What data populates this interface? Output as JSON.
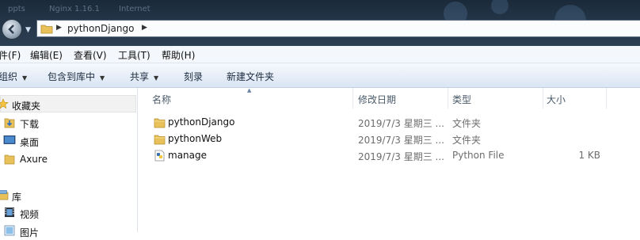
{
  "window": {
    "address_crumb": "pythonDjango",
    "bg_hints": [
      "ppts",
      "Nginx 1.16.1",
      "Internet"
    ]
  },
  "menu": {
    "items": [
      "件(F)",
      "编辑(E)",
      "查看(V)",
      "工具(T)",
      "帮助(H)"
    ]
  },
  "toolbar": {
    "items": [
      {
        "label": "组织",
        "dropdown": true
      },
      {
        "label": "包含到库中",
        "dropdown": true
      },
      {
        "label": "共享",
        "dropdown": true
      },
      {
        "label": "刻录",
        "dropdown": false
      },
      {
        "label": "新建文件夹",
        "dropdown": false
      }
    ]
  },
  "navpane": {
    "items": [
      {
        "label": "收藏夹",
        "icon": "favorites-star-icon"
      },
      {
        "label": "下载",
        "icon": "download-folder-icon"
      },
      {
        "label": "桌面",
        "icon": "desktop-icon"
      },
      {
        "label": "Axure",
        "icon": "folder-icon"
      },
      {
        "label": "库",
        "icon": "library-icon"
      },
      {
        "label": "视频",
        "icon": "video-library-icon"
      },
      {
        "label": "图片",
        "icon": "picture-library-icon"
      }
    ]
  },
  "columns": [
    "名称",
    "修改日期",
    "类型",
    "大小"
  ],
  "files": [
    {
      "name": "pythonDjango",
      "date": "2019/7/3 星期三 ...",
      "type": "文件夹",
      "size": "",
      "icon": "folder-icon"
    },
    {
      "name": "pythonWeb",
      "date": "2019/7/3 星期三 ...",
      "type": "文件夹",
      "size": "",
      "icon": "folder-icon"
    },
    {
      "name": "manage",
      "date": "2019/7/3 星期三 ...",
      "type": "Python File",
      "size": "1 KB",
      "icon": "python-file-icon"
    }
  ],
  "colors": {
    "folder": "#e8c15a",
    "accent": "#3a6ea5"
  }
}
